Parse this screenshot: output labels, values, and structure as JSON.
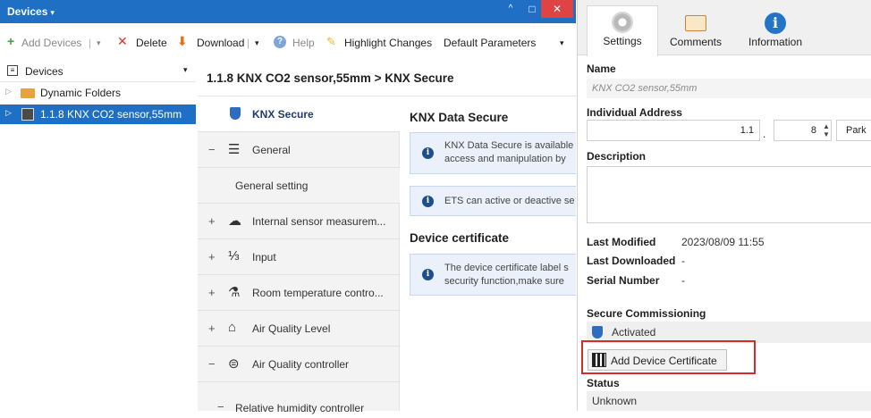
{
  "window": {
    "title": "Devices",
    "caret": "▾",
    "buttons": {
      "collapse": "^",
      "maximize": "□",
      "close": "✕"
    }
  },
  "toolbar": {
    "add_devices": "Add Devices",
    "delete": "Delete",
    "download": "Download",
    "help": "Help",
    "highlight_changes": "Highlight Changes",
    "default_parameters": "Default Parameters"
  },
  "tree": {
    "header": "Devices",
    "items": [
      {
        "label": "Dynamic Folders"
      },
      {
        "label": "1.1.8 KNX CO2 sensor,55mm"
      }
    ]
  },
  "main": {
    "breadcrumb": "1.1.8 KNX CO2 sensor,55mm > KNX Secure",
    "nav": [
      {
        "prefix": "",
        "label": "KNX Secure"
      },
      {
        "prefix": "−",
        "label": "General"
      },
      {
        "prefix": "",
        "label": "General setting"
      },
      {
        "prefix": "+",
        "label": "Internal sensor measurem..."
      },
      {
        "prefix": "+",
        "label": "Input"
      },
      {
        "prefix": "+",
        "label": "Room temperature contro..."
      },
      {
        "prefix": "+",
        "label": "Air Quality Level"
      },
      {
        "prefix": "−",
        "label": "Air Quality controller"
      },
      {
        "prefix": "−",
        "label": "Relative humidity controller"
      }
    ],
    "content": {
      "knx_title": "KNX Data Secure",
      "info1_line1": "KNX Data Secure is available",
      "info1_line2": "access and manipulation by",
      "info2": "ETS can active or deactive se",
      "cert_title": "Device certificate",
      "info3_line1": "The device certificate label s",
      "info3_line2": "security function,make sure"
    }
  },
  "panel": {
    "tabs": [
      {
        "label": "Settings",
        "icon": "gear-icon"
      },
      {
        "label": "Comments",
        "icon": "comment-icon"
      },
      {
        "label": "Information",
        "icon": "info-icon",
        "glyph": "i"
      }
    ],
    "name_label": "Name",
    "name_value": "KNX CO2 sensor,55mm",
    "address_label": "Individual Address",
    "address_area_line": "1.1",
    "address_dot": ".",
    "address_device": "8",
    "park_label": "Park",
    "description_label": "Description",
    "last_modified_label": "Last Modified",
    "last_modified_value": "2023/08/09 11:55",
    "last_downloaded_label": "Last Downloaded",
    "last_downloaded_value": "-",
    "serial_label": "Serial Number",
    "serial_value": "-",
    "secure_label": "Secure Commissioning",
    "secure_value": "Activated",
    "add_cert_button": "Add Device Certificate",
    "status_label": "Status",
    "status_value": "Unknown"
  },
  "colors": {
    "titlebar": "#1f6fc5",
    "selection": "#1f6fc5",
    "highlight_box": "#d42b2b",
    "shield": "#2d6cc0"
  }
}
